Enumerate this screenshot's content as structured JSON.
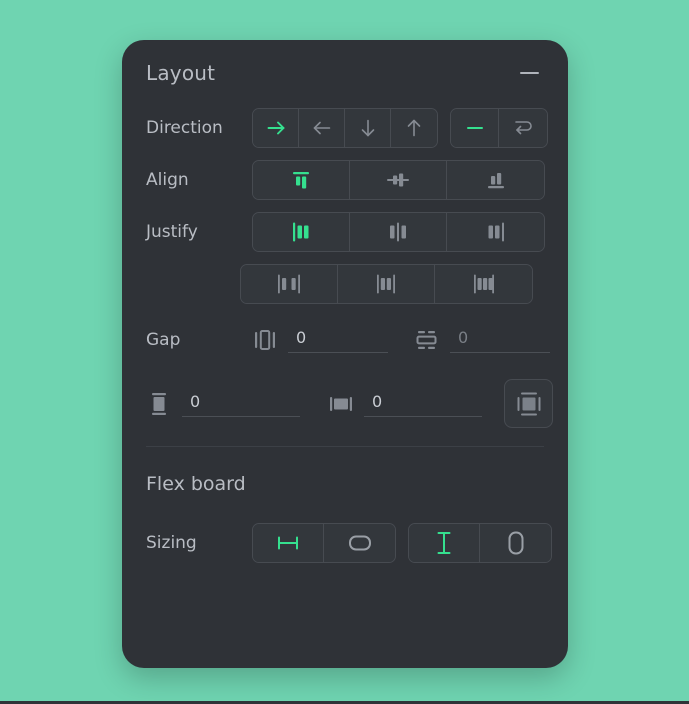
{
  "accent": "#35e08f",
  "colors": {
    "page_background": "#6fd4b1",
    "panel_background": "#2f3237",
    "control_background": "#33373c",
    "border": "#474b51",
    "label_text": "#b9bdc4",
    "icon_inactive": "#868b93",
    "accent_green": "#35e08f"
  },
  "panel": {
    "title": "Layout",
    "collapse_icon": "minus-icon"
  },
  "rows": {
    "direction": {
      "label": "Direction",
      "options": [
        {
          "name": "row",
          "icon": "arrow-right-icon",
          "selected": true
        },
        {
          "name": "row-reverse",
          "icon": "arrow-left-icon",
          "selected": false
        },
        {
          "name": "column",
          "icon": "arrow-down-icon",
          "selected": false
        },
        {
          "name": "column-reverse",
          "icon": "arrow-up-icon",
          "selected": false
        }
      ],
      "wrap_options": [
        {
          "name": "nowrap",
          "icon": "dash-icon",
          "selected": true
        },
        {
          "name": "wrap",
          "icon": "wrap-loop-icon",
          "selected": false
        }
      ]
    },
    "align": {
      "label": "Align",
      "options": [
        {
          "name": "align-start",
          "icon": "align-top-icon",
          "selected": true
        },
        {
          "name": "align-center",
          "icon": "align-middle-icon",
          "selected": false
        },
        {
          "name": "align-end",
          "icon": "align-bottom-icon",
          "selected": false
        }
      ]
    },
    "justify": {
      "label": "Justify",
      "options_row1": [
        {
          "name": "justify-start",
          "icon": "justify-start-icon",
          "selected": true
        },
        {
          "name": "justify-center",
          "icon": "justify-center-icon",
          "selected": false
        },
        {
          "name": "justify-end",
          "icon": "justify-end-icon",
          "selected": false
        }
      ],
      "options_row2": [
        {
          "name": "space-between",
          "icon": "justify-space-between-icon",
          "selected": false
        },
        {
          "name": "space-around",
          "icon": "justify-space-around-icon",
          "selected": false
        },
        {
          "name": "space-evenly",
          "icon": "justify-space-evenly-icon",
          "selected": false
        }
      ]
    },
    "gap": {
      "label": "Gap",
      "fields": [
        {
          "name": "gap-horizontal",
          "icon": "gap-horizontal-icon",
          "value": "0",
          "placeholder": "0"
        },
        {
          "name": "gap-vertical",
          "icon": "gap-vertical-icon",
          "value": "",
          "placeholder": "0"
        }
      ]
    },
    "padding": {
      "fields": [
        {
          "name": "padding-vertical",
          "icon": "padding-vertical-icon",
          "value": "0",
          "placeholder": "0"
        },
        {
          "name": "padding-horizontal",
          "icon": "padding-horizontal-icon",
          "value": "0",
          "placeholder": "0"
        }
      ],
      "individual_button": {
        "name": "padding-individual",
        "icon": "padding-individual-icon"
      }
    }
  },
  "flex_board": {
    "title": "Flex board",
    "sizing": {
      "label": "Sizing",
      "width_options": [
        {
          "name": "width-fixed",
          "icon": "width-fixed-icon",
          "selected": true
        },
        {
          "name": "width-hug",
          "icon": "width-hug-icon",
          "selected": false
        }
      ],
      "height_options": [
        {
          "name": "height-fixed",
          "icon": "height-fixed-icon",
          "selected": true
        },
        {
          "name": "height-hug",
          "icon": "height-hug-icon",
          "selected": false
        }
      ]
    }
  }
}
